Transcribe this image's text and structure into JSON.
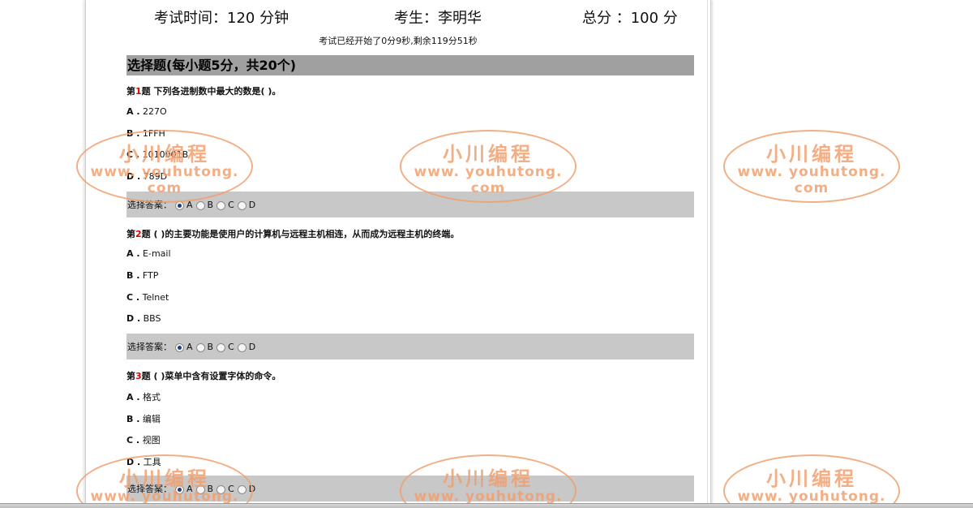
{
  "header": {
    "time_label": "考试时间：120 分钟",
    "student_label": "考生：李明华",
    "total_label": "总分 ：100 分"
  },
  "timer": "考试已经开始了0分9秒,剩余119分51秒",
  "section_title": "选择题(每小题5分，共20个)",
  "questions": [
    {
      "prefix": "第",
      "num": "1",
      "suffix": "题 下列各进制数中最大的数是( )。",
      "options": [
        {
          "key": "A .",
          "text": " 227O"
        },
        {
          "key": "B .",
          "text": " 1FFH"
        },
        {
          "key": "C .",
          "text": " 1010001B"
        },
        {
          "key": "D .",
          "text": " 789D"
        }
      ]
    },
    {
      "prefix": "第",
      "num": "2",
      "suffix": "题 ( )的主要功能是使用户的计算机与远程主机相连，从而成为远程主机的终端。",
      "options": [
        {
          "key": "A .",
          "text": " E-mail"
        },
        {
          "key": "B .",
          "text": " FTP"
        },
        {
          "key": "C .",
          "text": " Telnet"
        },
        {
          "key": "D .",
          "text": " BBS"
        }
      ]
    },
    {
      "prefix": "第",
      "num": "3",
      "suffix": "题 ( )菜单中含有设置字体的命令。",
      "options": [
        {
          "key": "A .",
          "text": " 格式"
        },
        {
          "key": "B .",
          "text": " 编辑"
        },
        {
          "key": "C .",
          "text": " 视图"
        },
        {
          "key": "D .",
          "text": " 工具"
        }
      ]
    }
  ],
  "answer_bar": {
    "label": "选择答案：",
    "choices": [
      "A",
      "B",
      "C",
      "D"
    ],
    "selected": "A"
  },
  "watermark": {
    "cn": "小川编程",
    "url": "www. youhutong. com",
    "color": "#f0a070"
  },
  "colors": {
    "section_bg": "#a0a0a0",
    "answer_bg": "#c8c8c8",
    "question_number": "#e00000"
  }
}
